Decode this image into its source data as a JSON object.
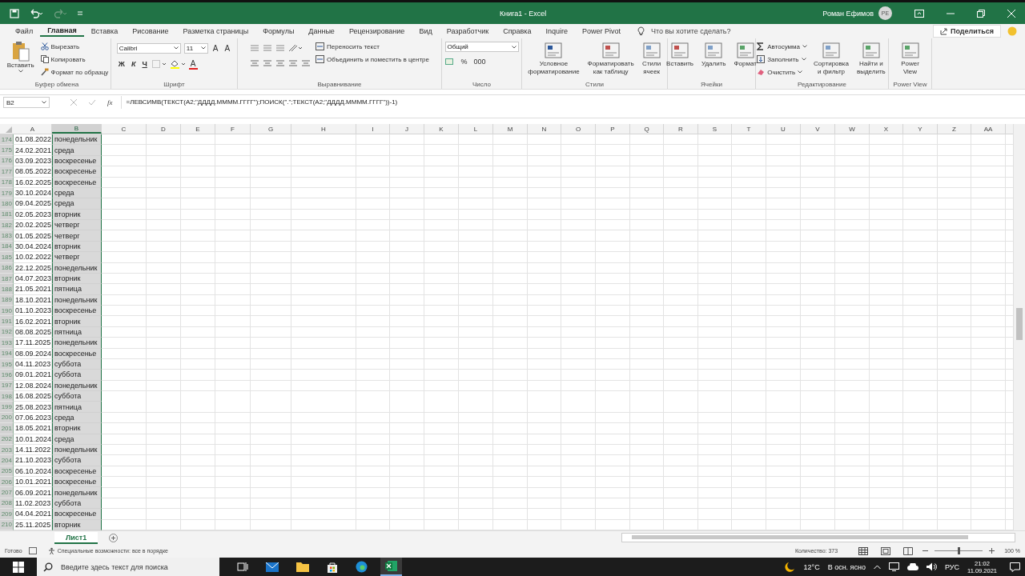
{
  "title_bar": {
    "document_title": "Книга1 - Excel",
    "user_name": "Роман Ефимов",
    "user_initials": "РЕ"
  },
  "menu_tabs": [
    {
      "label": "Файл",
      "selected": false
    },
    {
      "label": "Главная",
      "selected": true
    },
    {
      "label": "Вставка",
      "selected": false
    },
    {
      "label": "Рисование",
      "selected": false
    },
    {
      "label": "Разметка страницы",
      "selected": false
    },
    {
      "label": "Формулы",
      "selected": false
    },
    {
      "label": "Данные",
      "selected": false
    },
    {
      "label": "Рецензирование",
      "selected": false
    },
    {
      "label": "Вид",
      "selected": false
    },
    {
      "label": "Разработчик",
      "selected": false
    },
    {
      "label": "Справка",
      "selected": false
    },
    {
      "label": "Inquire",
      "selected": false
    },
    {
      "label": "Power Pivot",
      "selected": false
    }
  ],
  "tell_me": {
    "placeholder": "Что вы хотите сделать?"
  },
  "share_button": "Поделиться",
  "ribbon": {
    "groups": [
      {
        "kind": "clipboard",
        "label": "Буфер обмена",
        "paste": "Вставить",
        "items": [
          "Вырезать",
          "Копировать",
          "Формат по образцу"
        ]
      },
      {
        "kind": "font",
        "label": "Шрифт",
        "font": "Calibri",
        "size": "11",
        "size_buttons": [
          "A",
          "A"
        ],
        "styles": [
          "Ж",
          "К",
          "Ч"
        ],
        "font_color": "A"
      },
      {
        "kind": "alignment",
        "label": "Выравнивание",
        "items": [
          "Переносить текст",
          "Объединить и поместить в центре"
        ]
      },
      {
        "kind": "number",
        "label": "Число",
        "format": "Общий",
        "symbols": [
          "%",
          "000"
        ]
      },
      {
        "kind": "large",
        "label": "Стили",
        "buttons": [
          {
            "lines": [
              "Условное",
              "форматирование"
            ]
          },
          {
            "lines": [
              "Форматировать",
              "как таблицу"
            ]
          },
          {
            "lines": [
              "Стили",
              "ячеек"
            ]
          }
        ]
      },
      {
        "kind": "large",
        "label": "Ячейки",
        "buttons": [
          {
            "lines": [
              "Вставить"
            ]
          },
          {
            "lines": [
              "Удалить"
            ]
          },
          {
            "lines": [
              "Формат"
            ]
          }
        ]
      },
      {
        "kind": "editing",
        "label": "Редактирование",
        "items": [
          "Автосумма",
          "Заполнить",
          "Очистить"
        ],
        "buttons": [
          {
            "lines": [
              "Сортировка",
              "и фильтр"
            ]
          },
          {
            "lines": [
              "Найти и",
              "выделить"
            ]
          }
        ]
      },
      {
        "kind": "large",
        "label": "Power View",
        "buttons": [
          {
            "lines": [
              "Power",
              "View"
            ]
          }
        ]
      }
    ]
  },
  "formula_bar": {
    "name_box": "B2",
    "function_button": "fx",
    "formula": "=ЛЕВСИМВ(ТЕКСТ(A2;\"ДДДД.ММММ.ГГГГ\");ПОИСК(\".\";ТЕКСТ(A2;\"ДДДД.ММММ.ГГГГ\"))-1)"
  },
  "columns": [
    {
      "label": "A",
      "selected": false
    },
    {
      "label": "B",
      "selected": true
    },
    {
      "label": "C",
      "selected": false
    },
    {
      "label": "D",
      "selected": false
    },
    {
      "label": "E",
      "selected": false
    },
    {
      "label": "F",
      "selected": false
    },
    {
      "label": "G",
      "selected": false
    },
    {
      "label": "H",
      "selected": false
    },
    {
      "label": "I",
      "selected": false
    },
    {
      "label": "J",
      "selected": false
    },
    {
      "label": "K",
      "selected": false
    },
    {
      "label": "L",
      "selected": false
    },
    {
      "label": "M",
      "selected": false
    },
    {
      "label": "N",
      "selected": false
    },
    {
      "label": "O",
      "selected": false
    },
    {
      "label": "P",
      "selected": false
    },
    {
      "label": "Q",
      "selected": false
    },
    {
      "label": "R",
      "selected": false
    },
    {
      "label": "S",
      "selected": false
    },
    {
      "label": "T",
      "selected": false
    },
    {
      "label": "U",
      "selected": false
    },
    {
      "label": "V",
      "selected": false
    },
    {
      "label": "W",
      "selected": false
    },
    {
      "label": "X",
      "selected": false
    },
    {
      "label": "Y",
      "selected": false
    },
    {
      "label": "Z",
      "selected": false
    },
    {
      "label": "AA",
      "selected": false
    }
  ],
  "rows": [
    {
      "number": "174",
      "cells": [
        "01.08.2022",
        "понедельник"
      ]
    },
    {
      "number": "175",
      "cells": [
        "24.02.2021",
        "среда"
      ]
    },
    {
      "number": "176",
      "cells": [
        "03.09.2023",
        "воскресенье"
      ]
    },
    {
      "number": "177",
      "cells": [
        "08.05.2022",
        "воскресенье"
      ]
    },
    {
      "number": "178",
      "cells": [
        "16.02.2025",
        "воскресенье"
      ]
    },
    {
      "number": "179",
      "cells": [
        "30.10.2024",
        "среда"
      ]
    },
    {
      "number": "180",
      "cells": [
        "09.04.2025",
        "среда"
      ]
    },
    {
      "number": "181",
      "cells": [
        "02.05.2023",
        "вторник"
      ]
    },
    {
      "number": "182",
      "cells": [
        "20.02.2025",
        "четверг"
      ]
    },
    {
      "number": "183",
      "cells": [
        "01.05.2025",
        "четверг"
      ]
    },
    {
      "number": "184",
      "cells": [
        "30.04.2024",
        "вторник"
      ]
    },
    {
      "number": "185",
      "cells": [
        "10.02.2022",
        "четверг"
      ]
    },
    {
      "number": "186",
      "cells": [
        "22.12.2025",
        "понедельник"
      ]
    },
    {
      "number": "187",
      "cells": [
        "04.07.2023",
        "вторник"
      ]
    },
    {
      "number": "188",
      "cells": [
        "21.05.2021",
        "пятница"
      ]
    },
    {
      "number": "189",
      "cells": [
        "18.10.2021",
        "понедельник"
      ]
    },
    {
      "number": "190",
      "cells": [
        "01.10.2023",
        "воскресенье"
      ]
    },
    {
      "number": "191",
      "cells": [
        "16.02.2021",
        "вторник"
      ]
    },
    {
      "number": "192",
      "cells": [
        "08.08.2025",
        "пятница"
      ]
    },
    {
      "number": "193",
      "cells": [
        "17.11.2025",
        "понедельник"
      ]
    },
    {
      "number": "194",
      "cells": [
        "08.09.2024",
        "воскресенье"
      ]
    },
    {
      "number": "195",
      "cells": [
        "04.11.2023",
        "суббота"
      ]
    },
    {
      "number": "196",
      "cells": [
        "09.01.2021",
        "суббота"
      ]
    },
    {
      "number": "197",
      "cells": [
        "12.08.2024",
        "понедельник"
      ]
    },
    {
      "number": "198",
      "cells": [
        "16.08.2025",
        "суббота"
      ]
    },
    {
      "number": "199",
      "cells": [
        "25.08.2023",
        "пятница"
      ]
    },
    {
      "number": "200",
      "cells": [
        "07.06.2023",
        "среда"
      ]
    },
    {
      "number": "201",
      "cells": [
        "18.05.2021",
        "вторник"
      ]
    },
    {
      "number": "202",
      "cells": [
        "10.01.2024",
        "среда"
      ]
    },
    {
      "number": "203",
      "cells": [
        "14.11.2022",
        "понедельник"
      ]
    },
    {
      "number": "204",
      "cells": [
        "21.10.2023",
        "суббота"
      ]
    },
    {
      "number": "205",
      "cells": [
        "06.10.2024",
        "воскресенье"
      ]
    },
    {
      "number": "206",
      "cells": [
        "10.01.2021",
        "воскресенье"
      ]
    },
    {
      "number": "207",
      "cells": [
        "06.09.2021",
        "понедельник"
      ]
    },
    {
      "number": "208",
      "cells": [
        "11.02.2023",
        "суббота"
      ]
    },
    {
      "number": "209",
      "cells": [
        "04.04.2021",
        "воскресенье"
      ]
    },
    {
      "number": "210",
      "cells": [
        "25.11.2025",
        "вторник"
      ]
    }
  ],
  "sheet_tabs": [
    {
      "label": "Лист1",
      "selected": true
    }
  ],
  "status_bar": {
    "status": "Готово",
    "accessibility": "Специальные возможности: все в порядке",
    "count": "Количество: 373",
    "zoom": "100 %",
    "zoom_slider": {
      "level": 0.5
    }
  },
  "taskbar": {
    "search_placeholder": "Введите здесь текст для поиска",
    "temperature": "12°C",
    "weather": "В осн. ясно",
    "language": "РУС",
    "time": "21:02",
    "date": "11.09.2021"
  }
}
